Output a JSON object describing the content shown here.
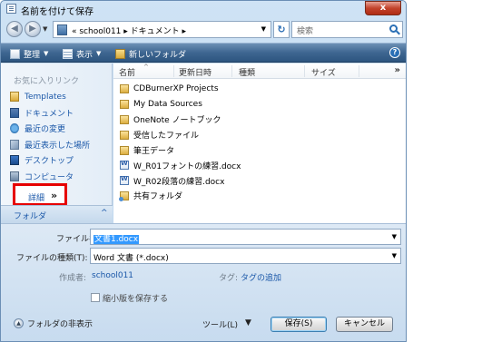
{
  "window": {
    "title": "名前を付けて保存",
    "close_label": "x"
  },
  "nav": {
    "address_path": "« school011 ▸ ドキュメント ▸",
    "search_placeholder": "検索"
  },
  "toolbar": {
    "organize": "整理",
    "view": "表示",
    "new_folder": "新しいフォルダ"
  },
  "sidebar": {
    "header": "お気に入りリンク",
    "items": [
      {
        "label": "Templates",
        "icon": "folder-icon"
      },
      {
        "label": "ドキュメント",
        "icon": "documents-icon"
      },
      {
        "label": "最近の変更",
        "icon": "recent-changes-icon"
      },
      {
        "label": "最近表示した場所",
        "icon": "recent-places-icon"
      },
      {
        "label": "デスクトップ",
        "icon": "desktop-icon"
      },
      {
        "label": "コンピュータ",
        "icon": "computer-icon"
      }
    ],
    "details_label": "詳細",
    "details_chevron": "»",
    "folder_label": "フォルダ",
    "folder_caret": "^"
  },
  "columns": [
    "名前",
    "更新日時",
    "種類",
    "サイズ"
  ],
  "files": [
    {
      "name": "CDBurnerXP Projects",
      "icon": "folder"
    },
    {
      "name": "My Data Sources",
      "icon": "folder"
    },
    {
      "name": "OneNote ノートブック",
      "icon": "folder"
    },
    {
      "name": "受信したファイル",
      "icon": "folder"
    },
    {
      "name": "筆王データ",
      "icon": "folder"
    },
    {
      "name": "W_R01フォントの練習.docx",
      "icon": "word-doc"
    },
    {
      "name": "W_R02段落の練習.docx",
      "icon": "word-doc"
    },
    {
      "name": "共有フォルダ",
      "icon": "shared-folder"
    }
  ],
  "form": {
    "filename_label": "ファイル名(N):",
    "filename_value": "文書1.docx",
    "filetype_label": "ファイルの種類(T):",
    "filetype_value": "Word 文書 (*.docx)",
    "author_label": "作成者:",
    "author_value": "school011",
    "tags_label": "タグ:",
    "tags_value": "タグの追加",
    "thumbnail_label": "縮小版を保存する",
    "thumbnail_checked": false
  },
  "footer": {
    "hide_folders": "フォルダの非表示",
    "tools": "ツール(L)",
    "tools_arrow": "▼",
    "save": "保存(S)",
    "cancel": "キャンセル"
  }
}
